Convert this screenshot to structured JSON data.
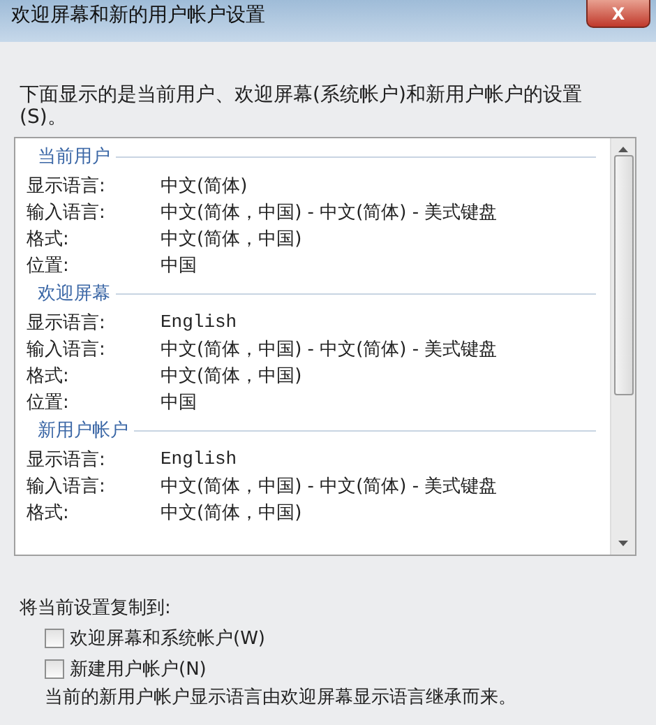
{
  "window": {
    "title": "欢迎屏幕和新的用户帐户设置",
    "close": "X"
  },
  "intro": "下面显示的是当前用户、欢迎屏幕(系统帐户)和新用户帐户的设置(S)。",
  "sections": [
    {
      "title": "当前用户",
      "rows": [
        {
          "label": "显示语言:",
          "value": "中文(简体)"
        },
        {
          "label": "输入语言:",
          "value": "中文(简体，中国) - 中文(简体) - 美式键盘"
        },
        {
          "label": "格式:",
          "value": "中文(简体，中国)"
        },
        {
          "label": "位置:",
          "value": "中国"
        }
      ]
    },
    {
      "title": "欢迎屏幕",
      "rows": [
        {
          "label": "显示语言:",
          "value": "English"
        },
        {
          "label": "输入语言:",
          "value": "中文(简体，中国) - 中文(简体) - 美式键盘"
        },
        {
          "label": "格式:",
          "value": "中文(简体，中国)"
        },
        {
          "label": "位置:",
          "value": "中国"
        }
      ]
    },
    {
      "title": "新用户帐户",
      "rows": [
        {
          "label": "显示语言:",
          "value": "English"
        },
        {
          "label": "输入语言:",
          "value": "中文(简体，中国) - 中文(简体) - 美式键盘"
        },
        {
          "label": "格式:",
          "value": "中文(简体，中国)"
        }
      ]
    }
  ],
  "copy_to": {
    "label": "将当前设置复制到:",
    "options": [
      {
        "label": "欢迎屏幕和系统帐户(W)",
        "checked": false
      },
      {
        "label": "新建用户帐户(N)",
        "checked": false
      }
    ]
  },
  "note": "当前的新用户帐户显示语言由欢迎屏幕显示语言继承而来。"
}
